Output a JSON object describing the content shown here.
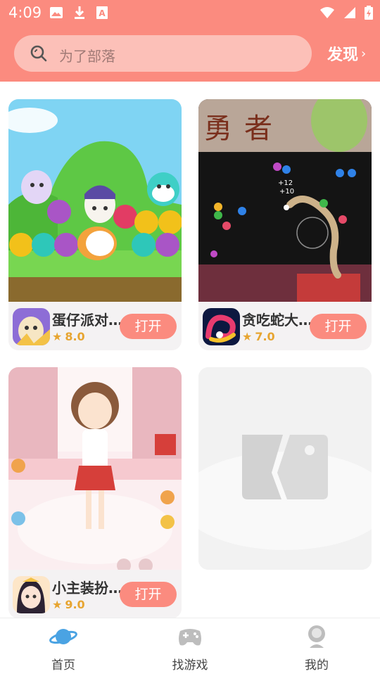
{
  "status_bar": {
    "time": "4:09",
    "icons_left": [
      "image-icon",
      "download-icon",
      "font-icon"
    ],
    "icons_right": [
      "wifi-icon",
      "signal-icon",
      "battery-icon"
    ]
  },
  "search": {
    "placeholder": "为了部落",
    "discover_label": "发现",
    "discover_chevron": "›"
  },
  "games": [
    {
      "name": "蛋仔派对...",
      "rating": "8.0",
      "button": "打开"
    },
    {
      "name": "贪吃蛇大...",
      "rating": "7.0",
      "button": "打开"
    },
    {
      "name": "小主装扮...",
      "rating": "9.0",
      "button": "打开"
    }
  ],
  "tabs": [
    {
      "label": "首页",
      "icon": "planet-icon",
      "active": true
    },
    {
      "label": "找游戏",
      "icon": "gamepad-icon",
      "active": false
    },
    {
      "label": "我的",
      "icon": "profile-icon",
      "active": false
    }
  ],
  "colors": {
    "accent": "#fb8b7f",
    "search_bg": "#fcc0b8",
    "rating": "#e7a531",
    "active_tab": "#4aa3e3"
  }
}
